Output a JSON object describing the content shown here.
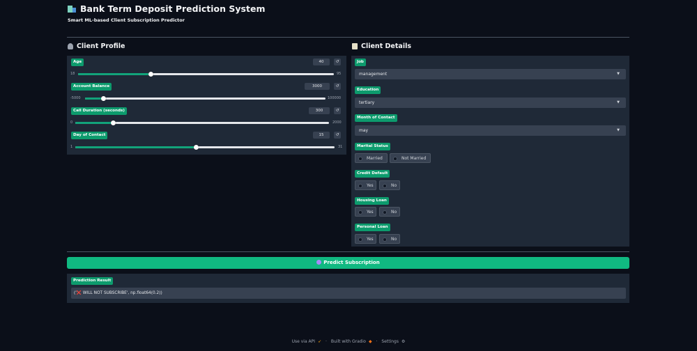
{
  "header": {
    "title": "Bank Term Deposit Prediction System",
    "subtitle": "Smart ML-based Client Subscription Predictor"
  },
  "client_profile": {
    "title": "Client Profile",
    "sliders": [
      {
        "label": "Age",
        "value": "40",
        "min": "18",
        "max": "95",
        "fraction": 0.286
      },
      {
        "label": "Account Balance",
        "value": "3000",
        "min": "-5000",
        "max": "100000",
        "fraction": 0.076
      },
      {
        "label": "Call Duration (seconds)",
        "value": "300",
        "min": "0",
        "max": "2000",
        "fraction": 0.15
      },
      {
        "label": "Day of Contact",
        "value": "15",
        "min": "1",
        "max": "31",
        "fraction": 0.467
      }
    ],
    "reset_glyph": "↺"
  },
  "client_details": {
    "title": "Client Details",
    "job": {
      "label": "Job",
      "value": "management"
    },
    "education": {
      "label": "Education",
      "value": "tertiary"
    },
    "month": {
      "label": "Month of Contact",
      "value": "may"
    },
    "marital": {
      "label": "Marital Status",
      "options": [
        "Married",
        "Not Married"
      ]
    },
    "credit_default": {
      "label": "Credit Default",
      "options": [
        "Yes",
        "No"
      ]
    },
    "housing_loan": {
      "label": "Housing Loan",
      "options": [
        "Yes",
        "No"
      ]
    },
    "personal_loan": {
      "label": "Personal Loan",
      "options": [
        "Yes",
        "No"
      ]
    },
    "caret": "▼"
  },
  "predict": {
    "label": "Predict Subscription"
  },
  "result": {
    "label": "Prediction Result",
    "value": "('❌ WILL NOT SUBSCRIBE', np.float64(0.2))"
  },
  "footer": {
    "api": "Use via API",
    "built": "Built with Gradio",
    "settings": "Settings",
    "sep": "·"
  },
  "colors": {
    "background": "#0b0f19",
    "panel": "#1f2937",
    "accent": "#10b981",
    "badge": "#0d9b6d",
    "input": "#374151"
  }
}
